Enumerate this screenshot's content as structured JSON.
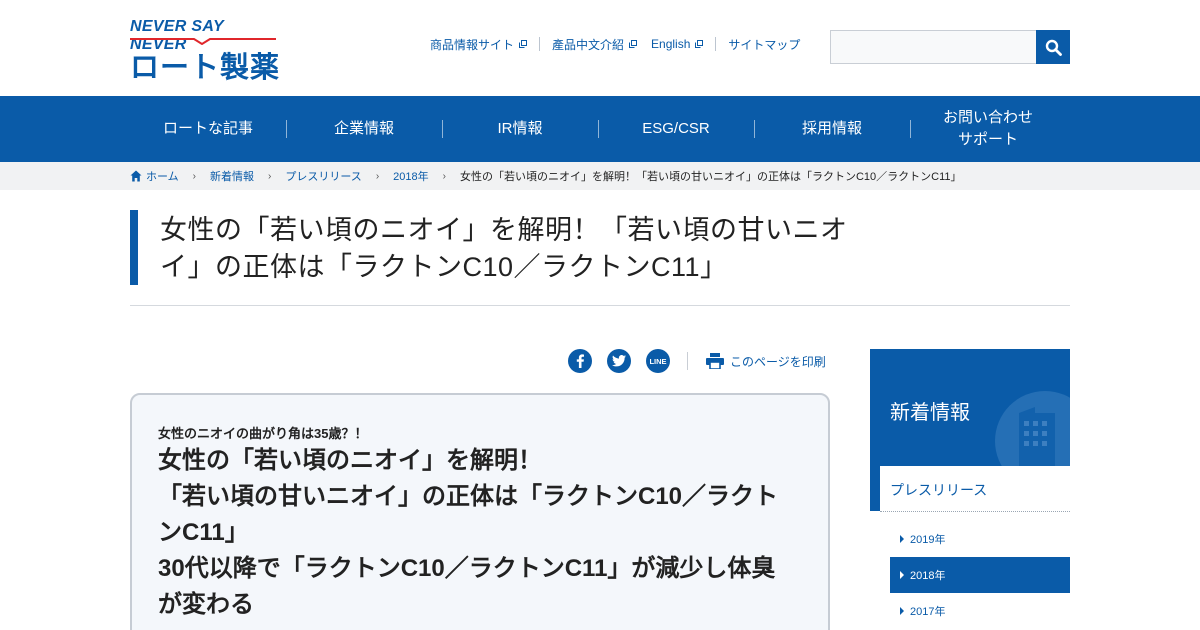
{
  "header": {
    "logo_tagline": "NEVER SAY NEVER",
    "logo_name": "ロート製薬",
    "util_links": [
      {
        "label": "商品情報サイト",
        "icon": "external-link-icon"
      },
      {
        "label": "產品中文介紹",
        "icon": "external-link-icon"
      },
      {
        "label": "English",
        "icon": "external-link-icon"
      },
      {
        "label": "サイトマップ"
      }
    ],
    "search": {
      "placeholder": "",
      "icon": "search-icon"
    }
  },
  "nav": {
    "items": [
      {
        "label": "ロートな記事"
      },
      {
        "label": "企業情報"
      },
      {
        "label": "IR情報"
      },
      {
        "label": "ESG/CSR"
      },
      {
        "label": "採用情報"
      },
      {
        "line1": "お問い合わせ",
        "line2": "サポート"
      }
    ]
  },
  "breadcrumb": {
    "items": [
      "ホーム",
      "新着情報",
      "プレスリリース",
      "2018年"
    ],
    "current": "女性の「若い頃のニオイ」を解明！「若い頃の甘いニオイ」の正体は「ラクトンC10／ラクトンC11」"
  },
  "article": {
    "title": "女性の「若い頃のニオイ」を解明！「若い頃の甘いニオイ」の正体は「ラクトンC10／ラクトンC11」",
    "share": {
      "icons": [
        "facebook-icon",
        "twitter-icon",
        "line-icon"
      ],
      "print_label": "このページを印刷"
    },
    "lead": {
      "subtitle": "女性のニオイの曲がり角は35歳？！",
      "lines": [
        "女性の「若い頃のニオイ」を解明！",
        "「若い頃の甘いニオイ」の正体は「ラクトンC10／ラクトンC11」",
        "30代以降で「ラクトンC10／ラクトンC11」が減少し体臭が変わる"
      ]
    }
  },
  "sidebar": {
    "title": "新着情報",
    "section": "プレスリリース",
    "years": [
      {
        "label": "2019年",
        "active": false
      },
      {
        "label": "2018年",
        "active": true
      },
      {
        "label": "2017年",
        "active": false
      }
    ]
  },
  "colors": {
    "brand": "#0a5ba8",
    "breadcrumb_bg": "#f1f2f3",
    "lead_bg": "#f4f7fb"
  }
}
